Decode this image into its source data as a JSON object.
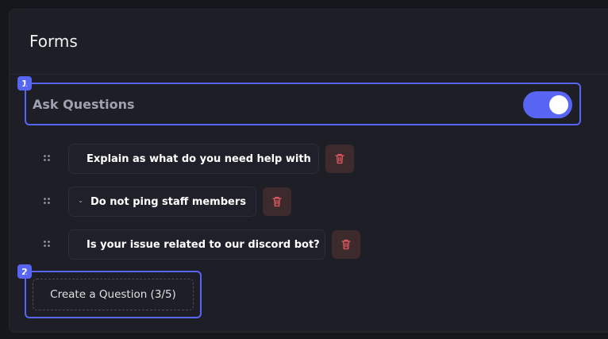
{
  "panel": {
    "title": "Forms"
  },
  "ask_questions": {
    "badge": "1",
    "label": "Ask Questions",
    "enabled": true
  },
  "questions": [
    {
      "text": "Explain as what do you need help with"
    },
    {
      "text": "Do not ping staff members"
    },
    {
      "text": "Is your issue related to our discord bot?"
    }
  ],
  "create": {
    "badge": "2",
    "label": "Create a Question (3/5)"
  },
  "colors": {
    "accent": "#5865f2",
    "delete_bg": "#3c2a2d",
    "delete_icon": "#e05a5f"
  },
  "icons": {
    "drag": "drag-handle-icon",
    "expand": "chevron-down-icon",
    "delete": "trash-icon"
  }
}
